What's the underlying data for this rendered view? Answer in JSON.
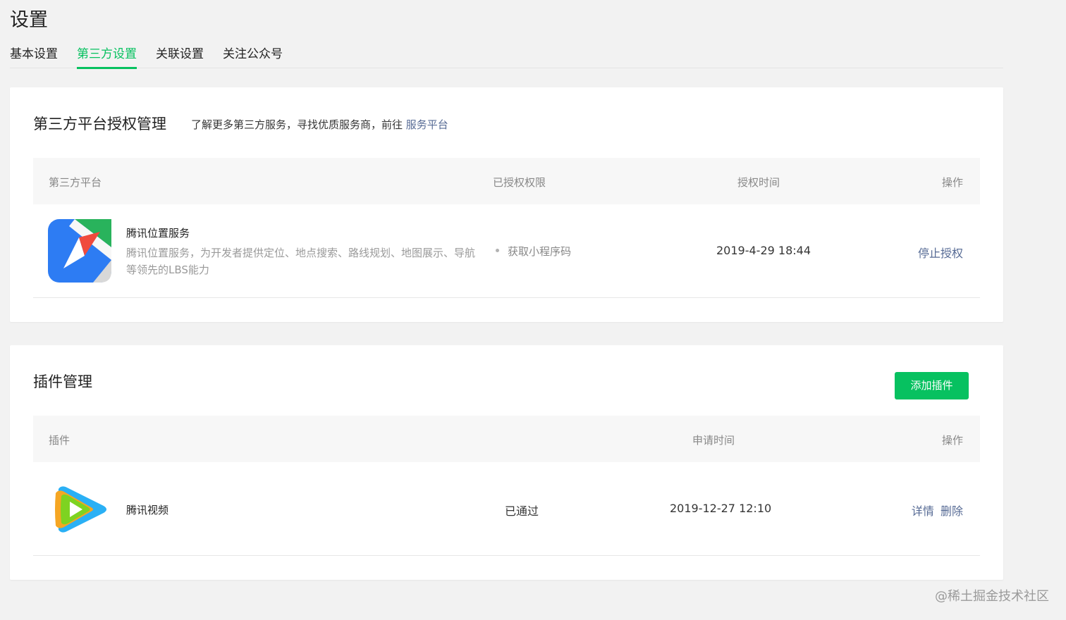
{
  "page": {
    "title": "设置"
  },
  "tabs": [
    {
      "label": "基本设置",
      "active": false
    },
    {
      "label": "第三方设置",
      "active": true
    },
    {
      "label": "关联设置",
      "active": false
    },
    {
      "label": "关注公众号",
      "active": false
    }
  ],
  "third_party": {
    "title": "第三方平台授权管理",
    "desc_text": "了解更多第三方服务，寻找优质服务商，前往 ",
    "desc_link": "服务平台",
    "columns": {
      "platform": "第三方平台",
      "permission": "已授权权限",
      "time": "授权时间",
      "action": "操作"
    },
    "rows": [
      {
        "icon": "tencent-location-icon",
        "name": "腾讯位置服务",
        "description": "腾讯位置服务，为开发者提供定位、地点搜索、路线规划、地图展示、导航等领先的LBS能力",
        "permission": "获取小程序码",
        "time": "2019-4-29 18:44",
        "action": "停止授权"
      }
    ]
  },
  "plugins": {
    "title": "插件管理",
    "add_button": "添加插件",
    "columns": {
      "plugin": "插件",
      "apply_time": "申请时间",
      "action": "操作"
    },
    "rows": [
      {
        "icon": "tencent-video-icon",
        "name": "腾讯视频",
        "status": "已通过",
        "time": "2019-12-27 12:10",
        "action_detail": "详情",
        "action_delete": "删除"
      }
    ]
  },
  "watermark": "@稀土掘金技术社区",
  "colors": {
    "accent": "#07c160",
    "link": "#576b95"
  }
}
